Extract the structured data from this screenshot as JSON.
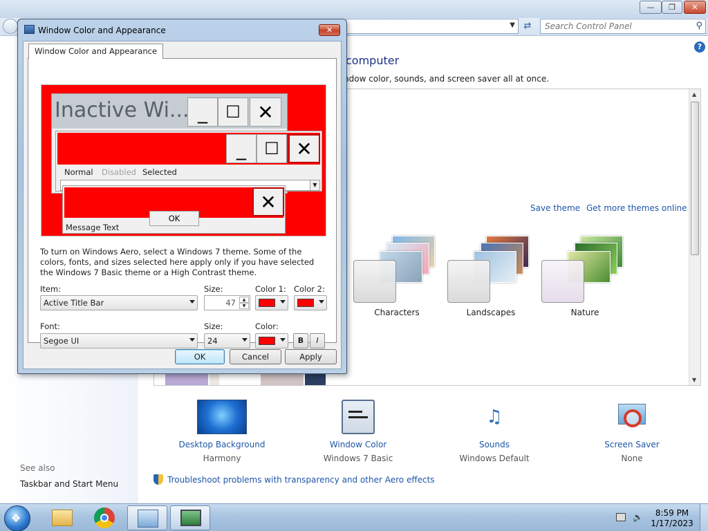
{
  "control_panel": {
    "search_placeholder": "Search Control Panel",
    "heading": "computer",
    "subheading": "ndow color, sounds, and screen saver all at once.",
    "save_theme": "Save theme",
    "more_themes": "Get more themes online",
    "themes": [
      {
        "name": "Characters"
      },
      {
        "name": "Landscapes"
      },
      {
        "name": "Nature"
      }
    ],
    "settings": [
      {
        "label": "Desktop Background",
        "value": "Harmony",
        "icon": "desktop-background-icon"
      },
      {
        "label": "Window Color",
        "value": "Windows 7 Basic",
        "icon": "window-color-icon"
      },
      {
        "label": "Sounds",
        "value": "Windows Default",
        "icon": "sounds-icon"
      },
      {
        "label": "Screen Saver",
        "value": "None",
        "icon": "screen-saver-icon"
      }
    ],
    "troubleshoot_link": "Troubleshoot problems with transparency and other Aero effects",
    "see_also": "See also",
    "taskbar_link": "Taskbar and Start Menu"
  },
  "dialog": {
    "title": "Window Color and Appearance",
    "tab": "Window Color and Appearance",
    "preview": {
      "inactive_title": "Inactive Wi...",
      "menu_normal": "Normal",
      "menu_disabled": "Disabled",
      "menu_selected": "Selected",
      "message_text": "Message Text",
      "ok": "OK"
    },
    "info_text": "To turn on Windows Aero, select a Windows 7 theme.  Some of the colors, fonts, and sizes selected here apply only if you have selected the Windows 7 Basic theme or a High Contrast theme.",
    "item_label": "Item:",
    "item_value": "Active Title Bar",
    "size_label": "Size:",
    "size_value": "47",
    "color1_label": "Color 1:",
    "color2_label": "Color 2:",
    "font_label": "Font:",
    "font_value": "Segoe UI",
    "font_size_label": "Size:",
    "font_size_value": "24",
    "font_color_label": "Color:",
    "bold": "B",
    "italic": "I",
    "ok_button": "OK",
    "cancel_button": "Cancel",
    "apply_button": "Apply",
    "swatch_color": "#ff0000"
  },
  "taskbar": {
    "time": "8:59 PM",
    "date": "1/17/2023",
    "items": [
      "start-orb",
      "file-explorer-icon",
      "chrome-icon",
      "control-panel-icon",
      "display-settings-icon"
    ]
  }
}
